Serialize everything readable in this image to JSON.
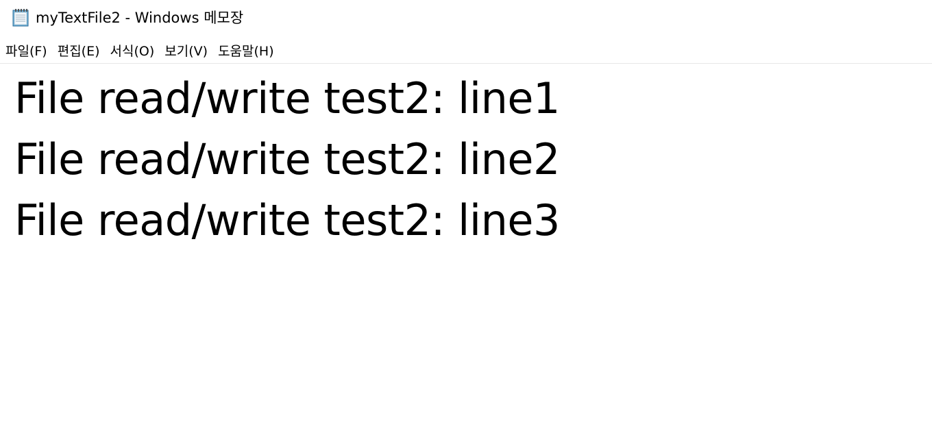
{
  "window": {
    "title": "myTextFile2 - Windows 메모장",
    "icon": "notepad-icon"
  },
  "menu": {
    "items": [
      {
        "label": "파일(F)"
      },
      {
        "label": "편집(E)"
      },
      {
        "label": "서식(O)"
      },
      {
        "label": "보기(V)"
      },
      {
        "label": "도움말(H)"
      }
    ]
  },
  "editor": {
    "lines": [
      "File read/write test2: line1",
      "File read/write test2: line2",
      "File read/write test2: line3"
    ]
  },
  "colors": {
    "background": "#ffffff",
    "text": "#000000",
    "divider": "#e6e6e6"
  }
}
